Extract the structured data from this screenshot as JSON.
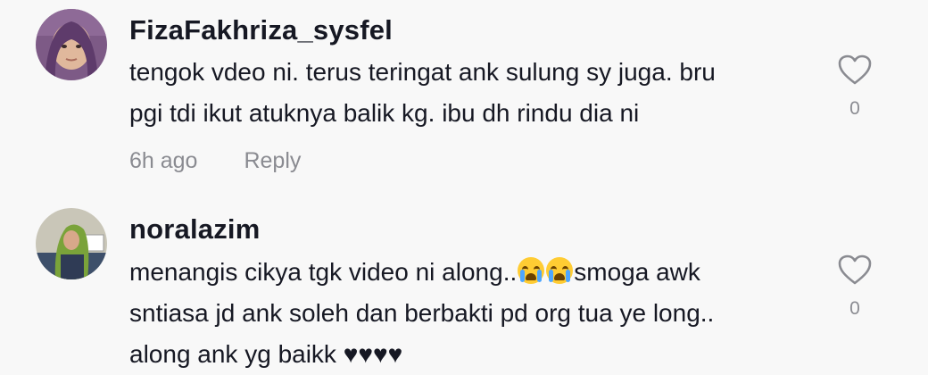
{
  "comments": [
    {
      "username": "FizaFakhriza_sysfel",
      "text": "tengok vdeo ni. terus teringat ank sulung sy juga. bru\npgi tdi ikut atuknya balik kg. ibu dh rindu dia ni",
      "time": "6h ago",
      "reply_label": "Reply",
      "likes": "0",
      "avatar_icon": "user-avatar-photo"
    },
    {
      "username": "noralazim",
      "text_part1": "menangis cikya tgk video ni along..",
      "emoji": "loudly-crying-face-icon",
      "text_part2": "smoga awk\nsntiasa jd ank soleh dan berbakti pd org tua ye long..\nalong ank yg baikk ♥♥♥♥",
      "likes": "0",
      "avatar_icon": "user-avatar-photo"
    }
  ],
  "colors": {
    "background": "#f8f8f8",
    "text_primary": "#161823",
    "text_secondary": "#8a8b91",
    "icon": "#8a8b91"
  }
}
